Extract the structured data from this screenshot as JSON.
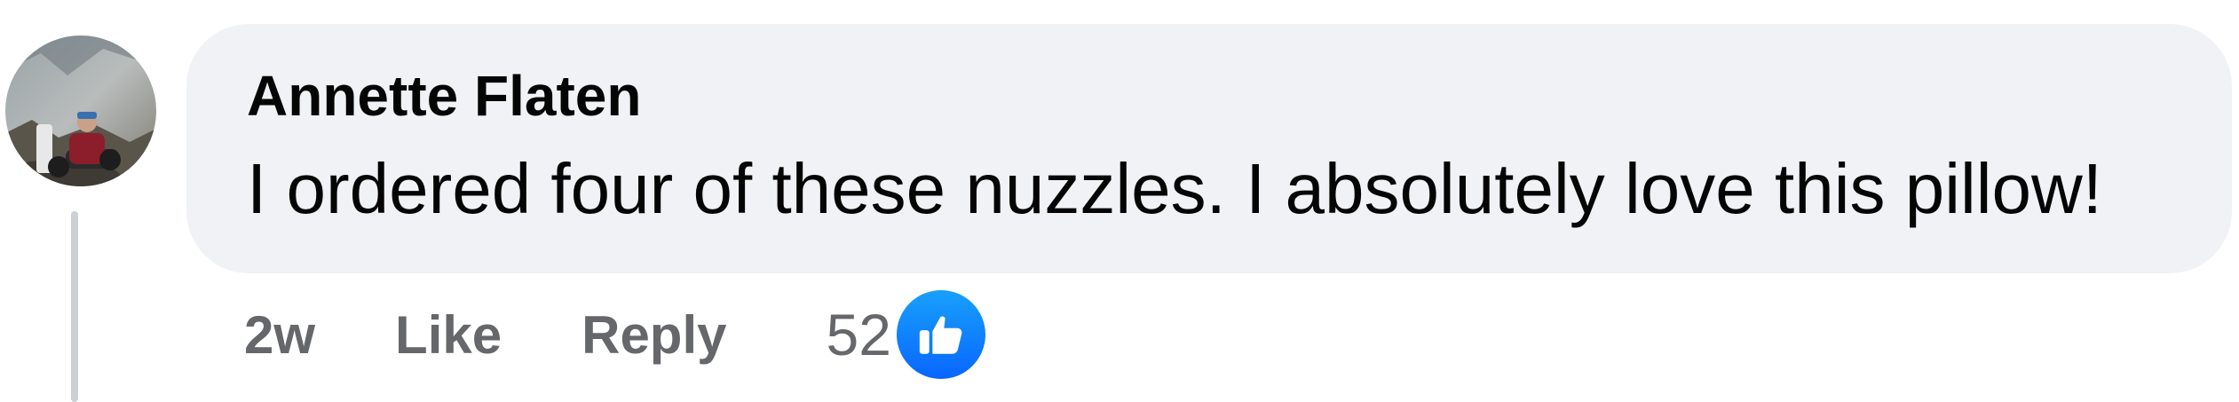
{
  "comment": {
    "author": "Annette Flaten",
    "text": "I ordered four of these nuzzles. I absolutely love this pillow!",
    "timestamp": "2w",
    "actions": {
      "like_label": "Like",
      "reply_label": "Reply"
    },
    "reactions": {
      "count": "52",
      "icon": "thumbs-up-icon",
      "icon_color": "#0866ff"
    }
  },
  "colors": {
    "bubble_background": "#f0f2f5",
    "primary_text": "#050505",
    "secondary_text": "#65676b",
    "thread_line": "#ccd0d5"
  }
}
